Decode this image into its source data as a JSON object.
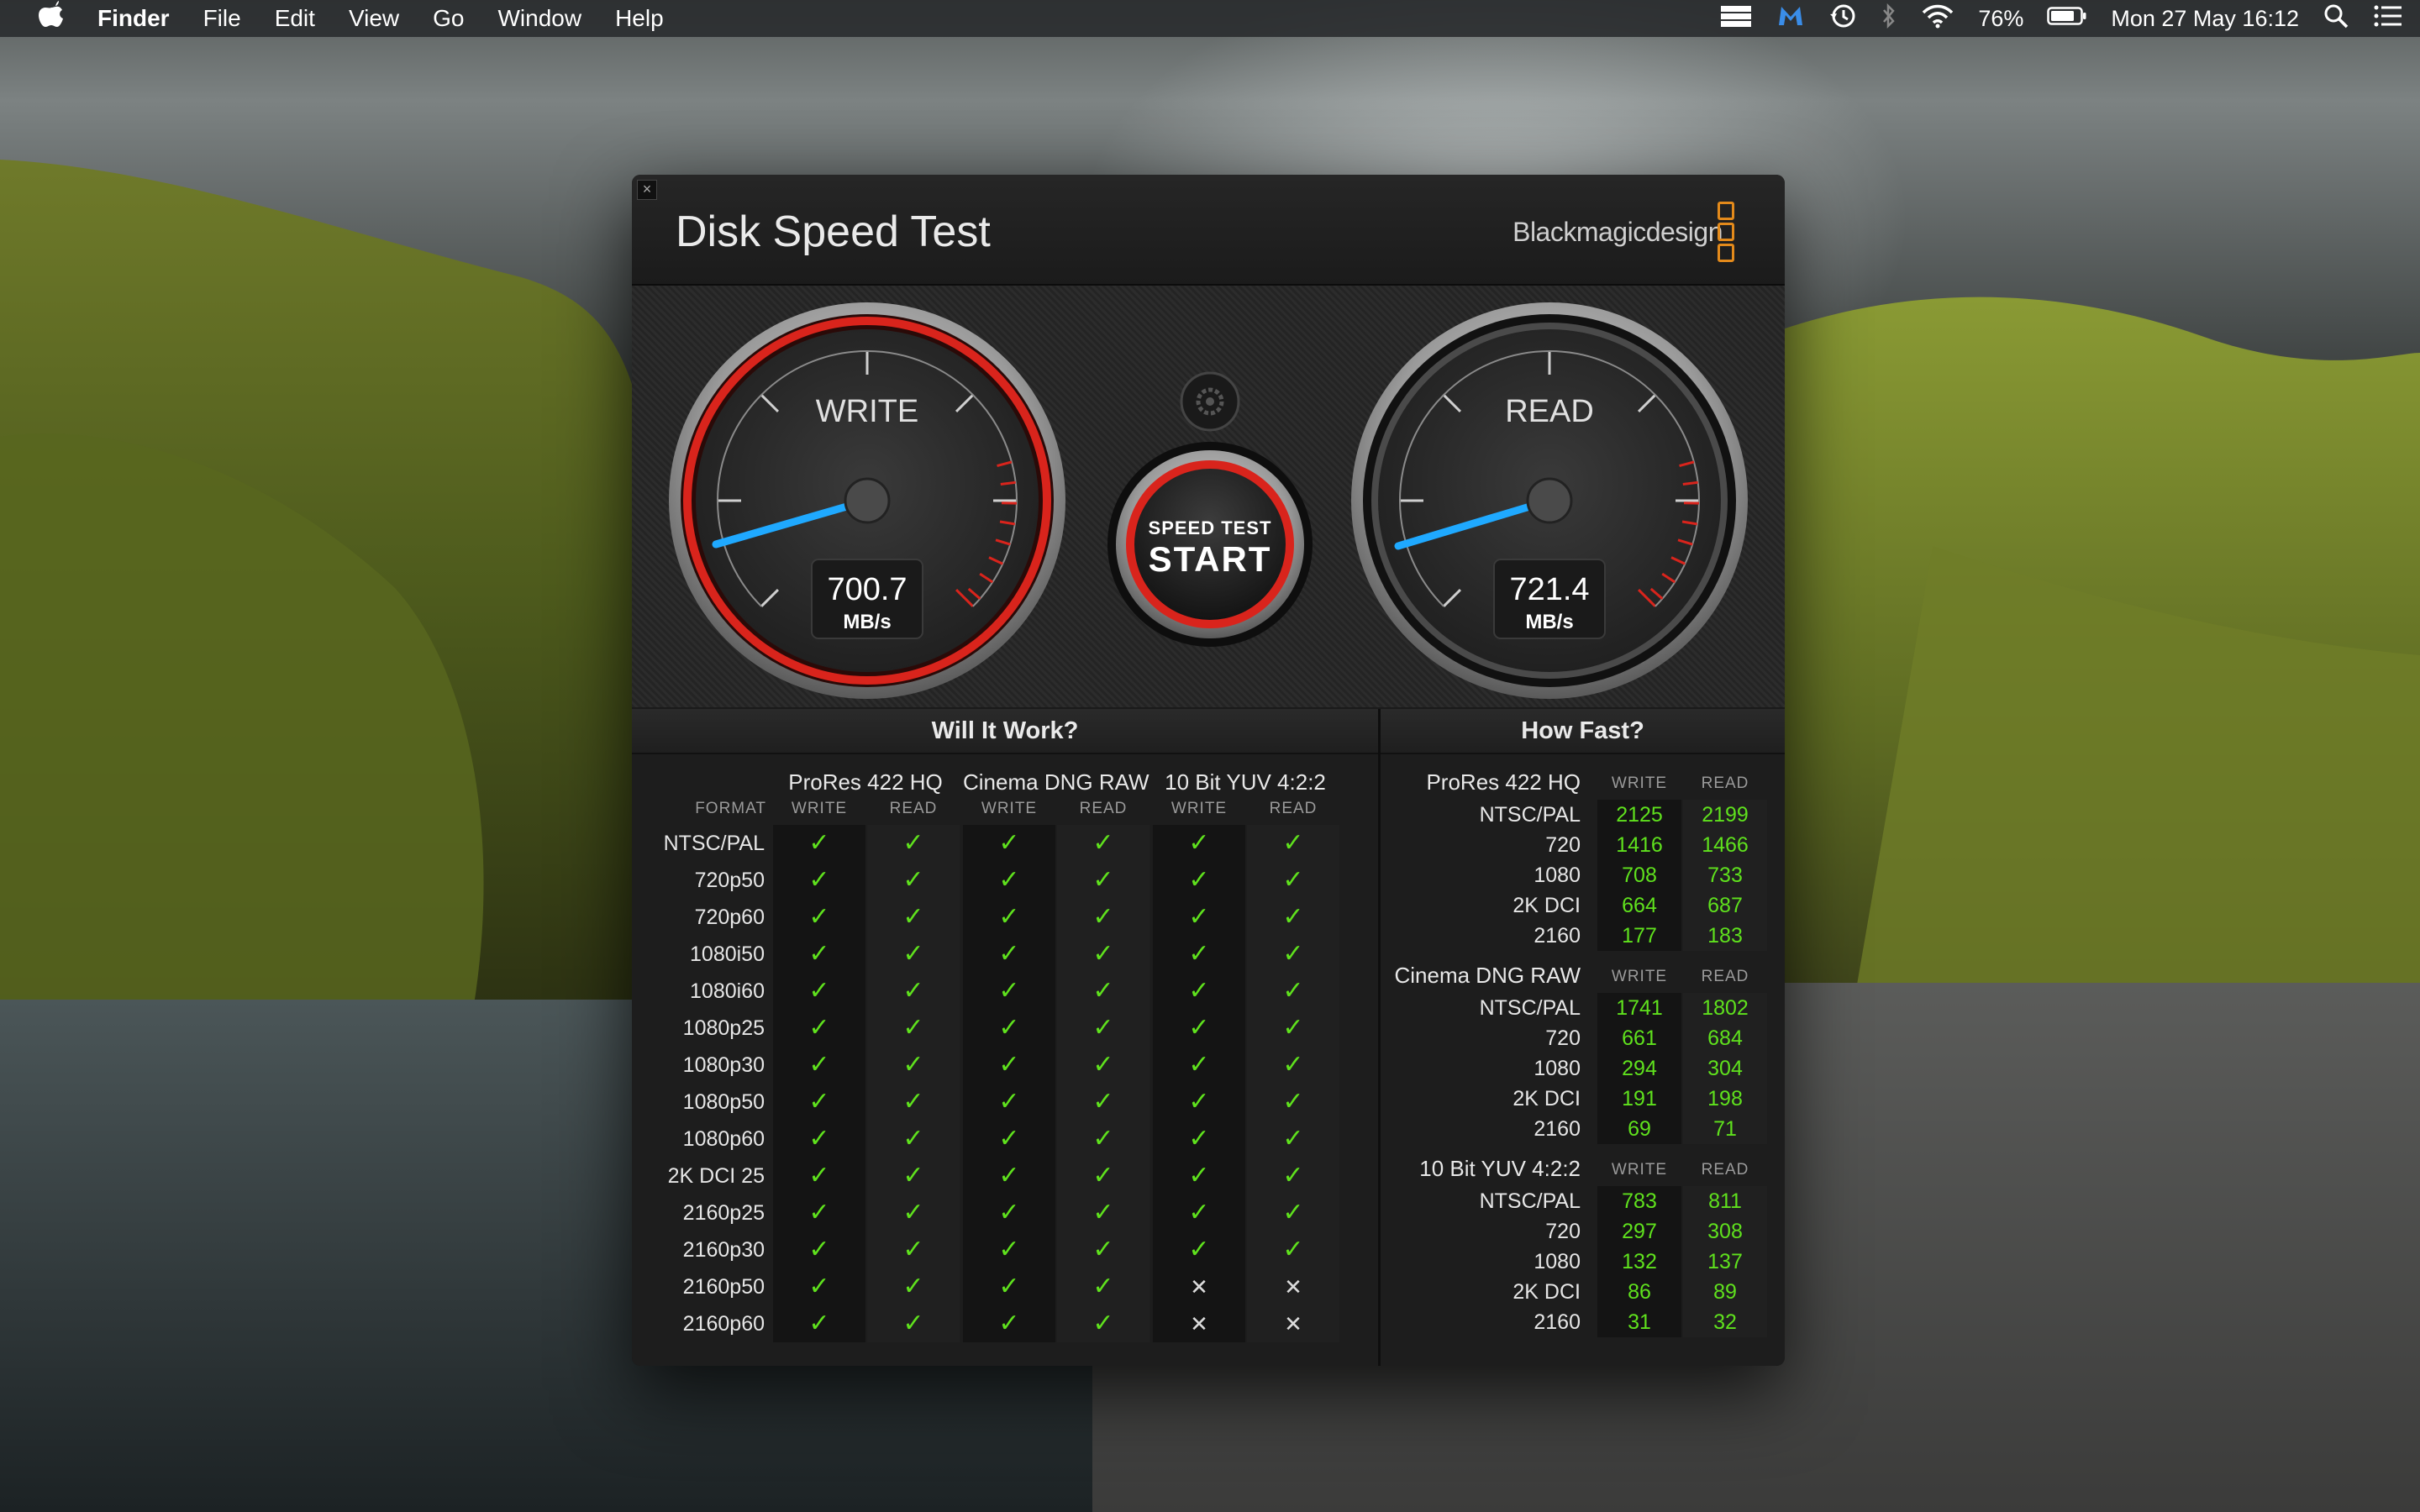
{
  "menubar": {
    "app_menu": "Finder",
    "items": [
      "File",
      "Edit",
      "View",
      "Go",
      "Window",
      "Help"
    ],
    "battery_percent": "76%",
    "datetime": "Mon 27 May  16:12"
  },
  "window": {
    "title": "Disk Speed Test",
    "brand": "Blackmagicdesign"
  },
  "gauges": {
    "write": {
      "label": "WRITE",
      "value": "700.7",
      "unit": "MB/s"
    },
    "read": {
      "label": "READ",
      "value": "721.4",
      "unit": "MB/s"
    },
    "start_button": {
      "small": "SPEED TEST",
      "big": "START"
    }
  },
  "will_it_work": {
    "heading": "Will It Work?",
    "format_header": "FORMAT",
    "groups": [
      {
        "name": "ProRes 422 HQ",
        "write": "WRITE",
        "read": "READ"
      },
      {
        "name": "Cinema DNG RAW",
        "write": "WRITE",
        "read": "READ"
      },
      {
        "name": "10 Bit YUV 4:2:2",
        "write": "WRITE",
        "read": "READ"
      }
    ],
    "rows": [
      {
        "format": "NTSC/PAL",
        "cells": [
          1,
          1,
          1,
          1,
          1,
          1
        ]
      },
      {
        "format": "720p50",
        "cells": [
          1,
          1,
          1,
          1,
          1,
          1
        ]
      },
      {
        "format": "720p60",
        "cells": [
          1,
          1,
          1,
          1,
          1,
          1
        ]
      },
      {
        "format": "1080i50",
        "cells": [
          1,
          1,
          1,
          1,
          1,
          1
        ]
      },
      {
        "format": "1080i60",
        "cells": [
          1,
          1,
          1,
          1,
          1,
          1
        ]
      },
      {
        "format": "1080p25",
        "cells": [
          1,
          1,
          1,
          1,
          1,
          1
        ]
      },
      {
        "format": "1080p30",
        "cells": [
          1,
          1,
          1,
          1,
          1,
          1
        ]
      },
      {
        "format": "1080p50",
        "cells": [
          1,
          1,
          1,
          1,
          1,
          1
        ]
      },
      {
        "format": "1080p60",
        "cells": [
          1,
          1,
          1,
          1,
          1,
          1
        ]
      },
      {
        "format": "2K DCI 25",
        "cells": [
          1,
          1,
          1,
          1,
          1,
          1
        ]
      },
      {
        "format": "2160p25",
        "cells": [
          1,
          1,
          1,
          1,
          1,
          1
        ]
      },
      {
        "format": "2160p30",
        "cells": [
          1,
          1,
          1,
          1,
          1,
          1
        ]
      },
      {
        "format": "2160p50",
        "cells": [
          1,
          1,
          1,
          1,
          0,
          0
        ]
      },
      {
        "format": "2160p60",
        "cells": [
          1,
          1,
          1,
          1,
          0,
          0
        ]
      }
    ]
  },
  "how_fast": {
    "heading": "How Fast?",
    "write_header": "WRITE",
    "read_header": "READ",
    "groups": [
      {
        "name": "ProRes 422 HQ",
        "rows": [
          {
            "label": "NTSC/PAL",
            "write": "2125",
            "read": "2199"
          },
          {
            "label": "720",
            "write": "1416",
            "read": "1466"
          },
          {
            "label": "1080",
            "write": "708",
            "read": "733"
          },
          {
            "label": "2K DCI",
            "write": "664",
            "read": "687"
          },
          {
            "label": "2160",
            "write": "177",
            "read": "183"
          }
        ]
      },
      {
        "name": "Cinema DNG RAW",
        "rows": [
          {
            "label": "NTSC/PAL",
            "write": "1741",
            "read": "1802"
          },
          {
            "label": "720",
            "write": "661",
            "read": "684"
          },
          {
            "label": "1080",
            "write": "294",
            "read": "304"
          },
          {
            "label": "2K DCI",
            "write": "191",
            "read": "198"
          },
          {
            "label": "2160",
            "write": "69",
            "read": "71"
          }
        ]
      },
      {
        "name": "10 Bit YUV 4:2:2",
        "rows": [
          {
            "label": "NTSC/PAL",
            "write": "783",
            "read": "811"
          },
          {
            "label": "720",
            "write": "297",
            "read": "308"
          },
          {
            "label": "1080",
            "write": "132",
            "read": "137"
          },
          {
            "label": "2K DCI",
            "write": "86",
            "read": "89"
          },
          {
            "label": "2160",
            "write": "31",
            "read": "32"
          }
        ]
      }
    ]
  },
  "colors": {
    "ok_green": "#5fe11d",
    "needle_blue": "#1fa9ff",
    "gauge_red": "#d9241c",
    "brand_orange": "#e38a1b"
  },
  "icons": {
    "check": "✓",
    "cross": "✕",
    "ok_value": "ok",
    "no_value": "no"
  }
}
